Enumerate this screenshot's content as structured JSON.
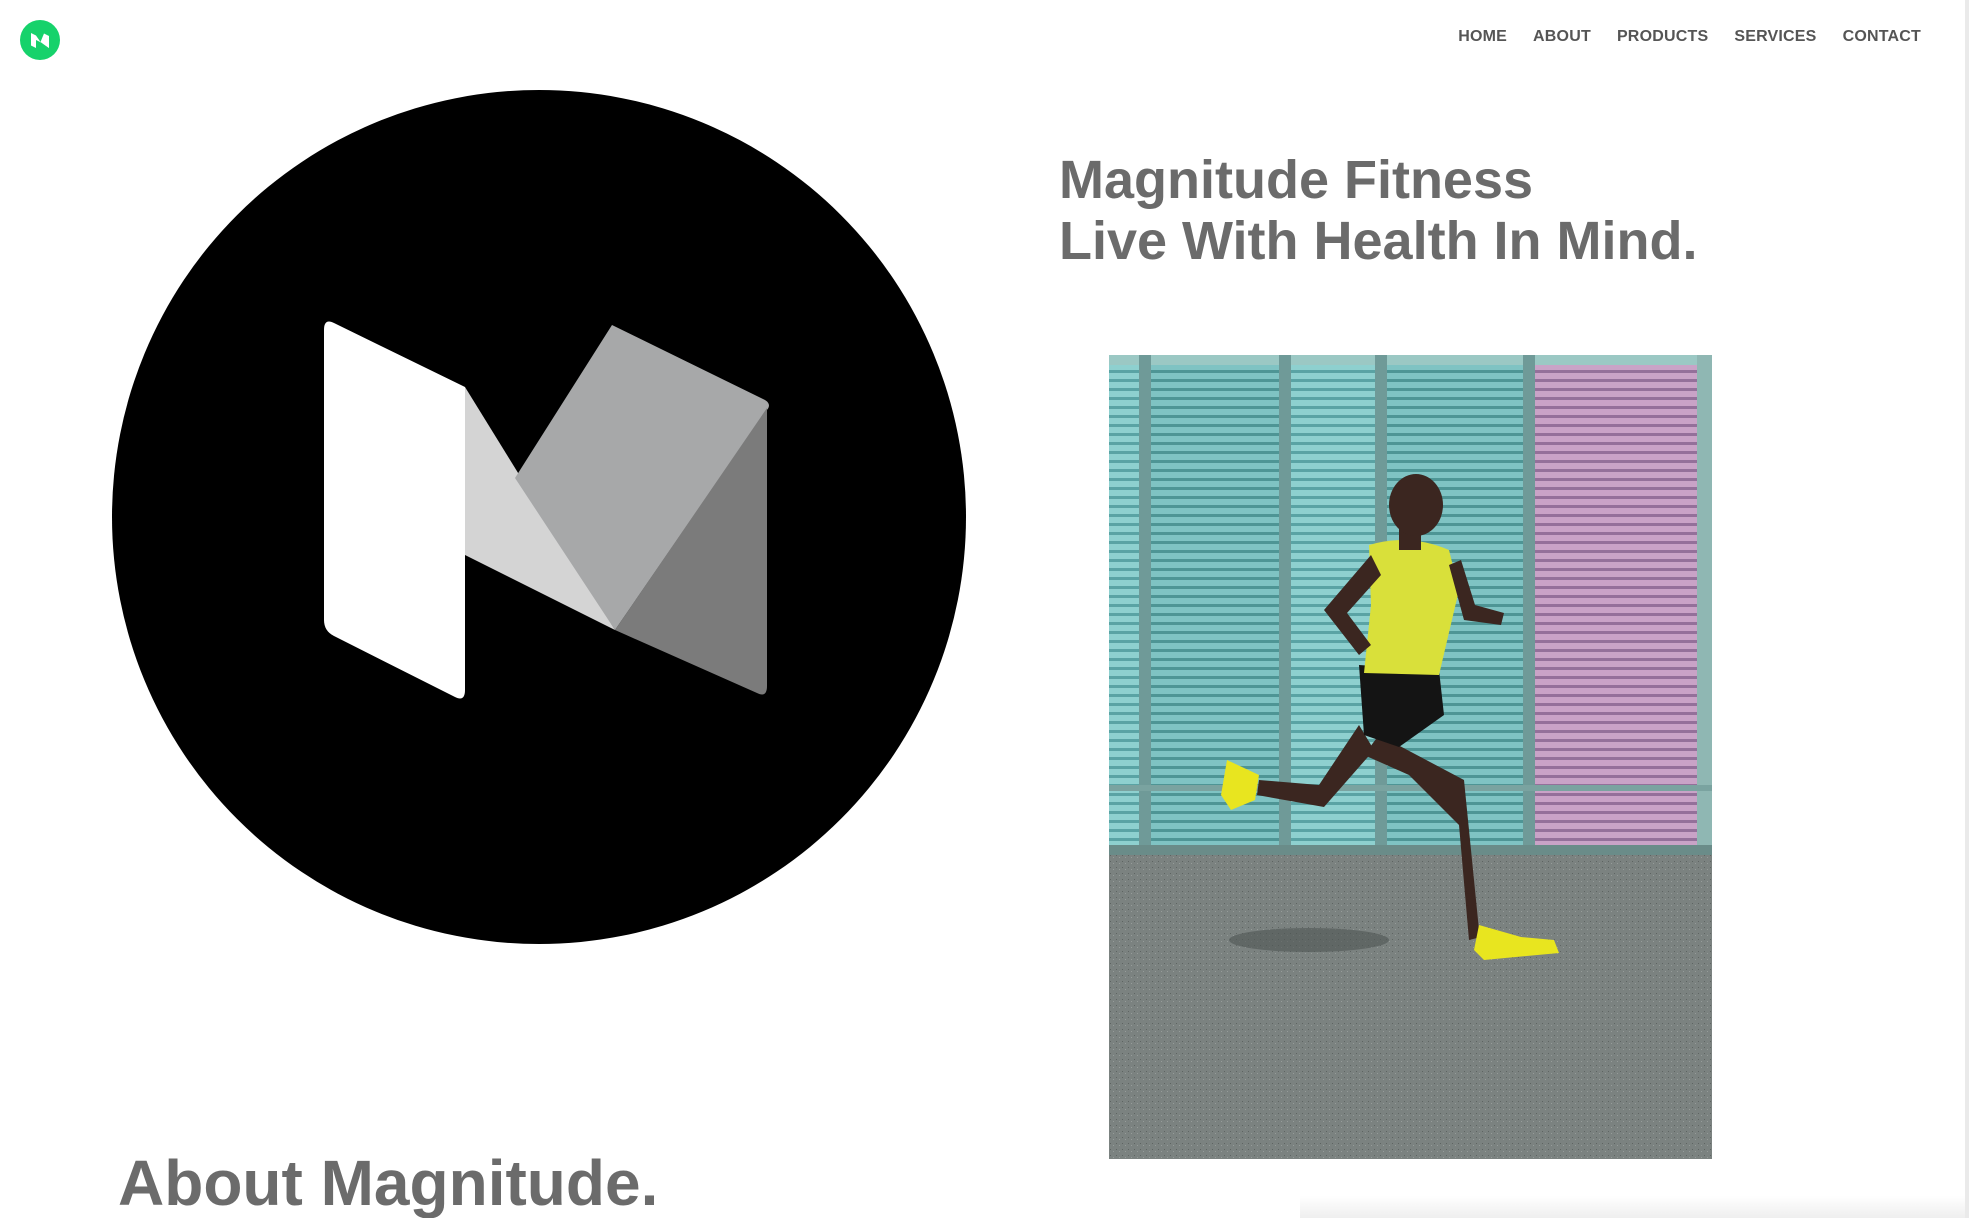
{
  "header": {
    "logo_icon": "magnitude-m-logo-icon",
    "logo_color": "#16d26b",
    "nav": [
      {
        "label": "HOME"
      },
      {
        "label": "ABOUT"
      },
      {
        "label": "PRODUCTS"
      },
      {
        "label": "SERVICES"
      },
      {
        "label": "CONTACT"
      }
    ]
  },
  "hero": {
    "title": "Magnitude Fitness",
    "tagline": "Live With Health In Mind.",
    "brand_mark_icon": "magnitude-m-mark-icon",
    "photo": "runner-photo"
  },
  "about": {
    "heading": "About Magnitude."
  },
  "colors": {
    "text": "#6b6b6b",
    "nav_text": "#555555",
    "brand_green": "#16d26b",
    "mark_background": "#000000"
  }
}
